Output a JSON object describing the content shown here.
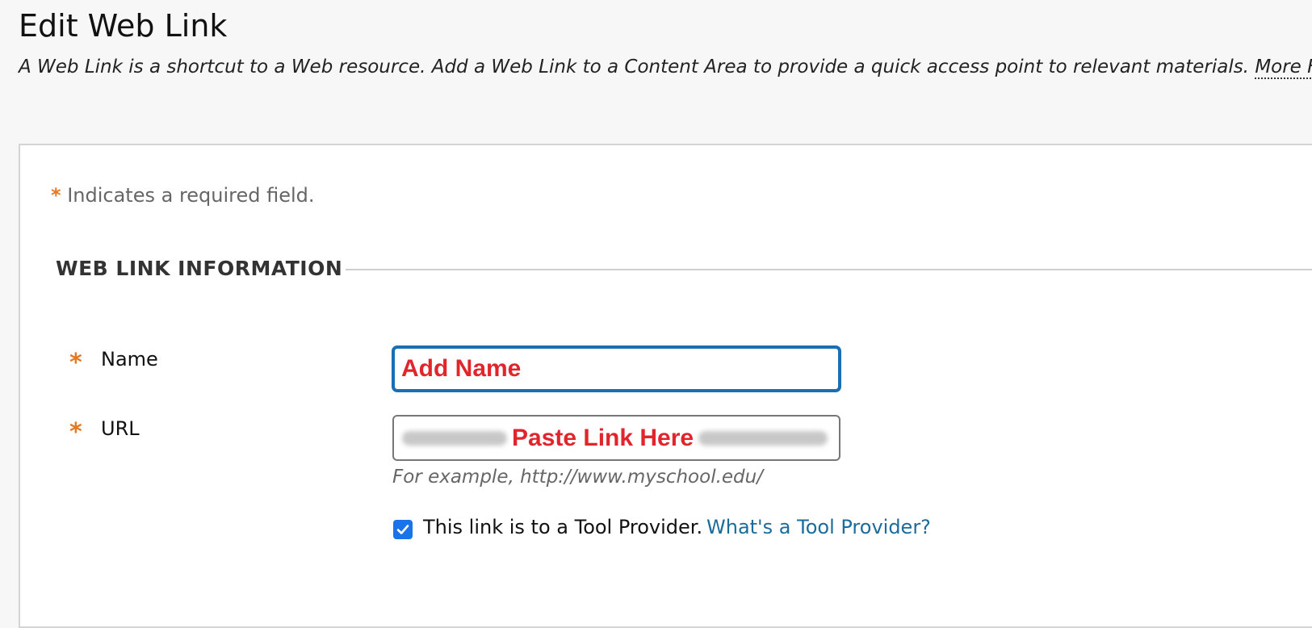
{
  "header": {
    "title": "Edit Web Link",
    "description": "A Web Link is a shortcut to a Web resource. Add a Web Link to a Content Area to provide a quick access point to relevant materials.",
    "more_help": "More Help"
  },
  "form": {
    "required_star": "*",
    "required_note": "Indicates a required field.",
    "section_title": "WEB LINK INFORMATION",
    "name": {
      "label": "Name",
      "value": "Add Name"
    },
    "url": {
      "label": "URL",
      "overlay_text": "Paste Link Here",
      "hint": "For example, http://www.myschool.edu/"
    },
    "tool_provider": {
      "checked": true,
      "label": "This link is to a Tool Provider.",
      "help_link": "What's a Tool Provider?"
    }
  },
  "colors": {
    "accent_blue": "#1a6fb3",
    "required_orange": "#e87722",
    "annotation_red": "#e0262c",
    "link_blue": "#1b6b9c"
  }
}
